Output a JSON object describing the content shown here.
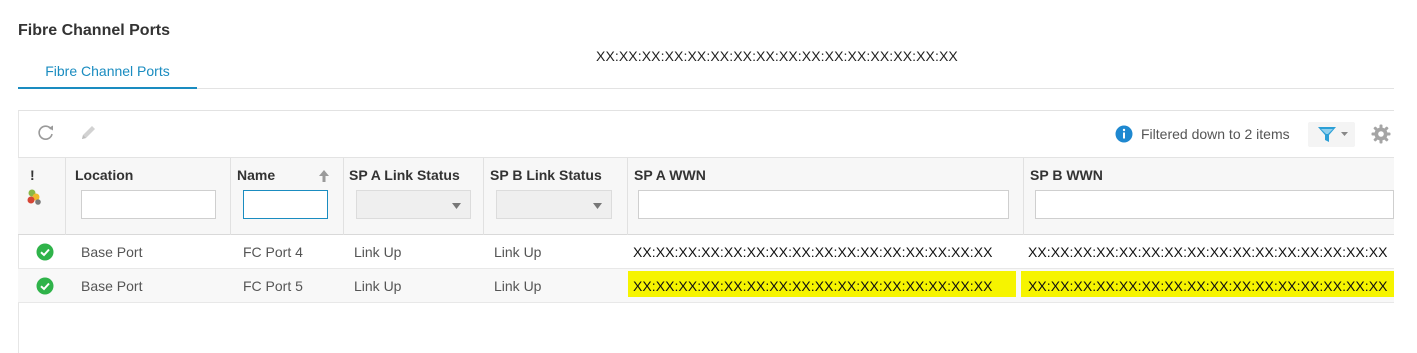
{
  "page": {
    "title": "Fibre Channel Ports",
    "wwn_header": "XX:XX:XX:XX:XX:XX:XX:XX:XX:XX:XX:XX:XX:XX:XX:XX"
  },
  "tabs": [
    {
      "label": "Fibre Channel Ports",
      "active": true
    }
  ],
  "toolbar": {
    "refresh_icon": "refresh-icon",
    "edit_icon": "edit-icon",
    "filter_status": "Filtered down to 2 items",
    "filter_icon": "filter-icon",
    "settings_icon": "gear-icon"
  },
  "table": {
    "columns": [
      {
        "key": "alert",
        "label": "!"
      },
      {
        "key": "location",
        "label": "Location"
      },
      {
        "key": "name",
        "label": "Name",
        "sorted": "ascending"
      },
      {
        "key": "spa_link",
        "label": "SP A Link Status"
      },
      {
        "key": "spb_link",
        "label": "SP B Link Status"
      },
      {
        "key": "spa_wwn",
        "label": "SP A WWN"
      },
      {
        "key": "spb_wwn",
        "label": "SP B WWN"
      }
    ],
    "filters": {
      "location": "",
      "name": "",
      "spa_link": "",
      "spb_link": "",
      "spa_wwn": "",
      "spb_wwn": ""
    },
    "rows": [
      {
        "status": "ok",
        "location": "Base Port",
        "name": "FC Port 4",
        "spa_link": "Link Up",
        "spb_link": "Link Up",
        "spa_wwn": "XX:XX:XX:XX:XX:XX:XX:XX:XX:XX:XX:XX:XX:XX:XX:XX",
        "spb_wwn": "XX:XX:XX:XX:XX:XX:XX:XX:XX:XX:XX:XX:XX:XX:XX:XX",
        "highlighted": false
      },
      {
        "status": "ok",
        "location": "Base Port",
        "name": "FC Port 5",
        "spa_link": "Link Up",
        "spb_link": "Link Up",
        "spa_wwn": "XX:XX:XX:XX:XX:XX:XX:XX:XX:XX:XX:XX:XX:XX:XX:XX",
        "spb_wwn": "XX:XX:XX:XX:XX:XX:XX:XX:XX:XX:XX:XX:XX:XX:XX:XX",
        "highlighted": true
      }
    ]
  },
  "colors": {
    "accent": "#1a8cc0",
    "ok": "#2fb34a",
    "info": "#1e88d0",
    "highlight": "#f6f400"
  }
}
